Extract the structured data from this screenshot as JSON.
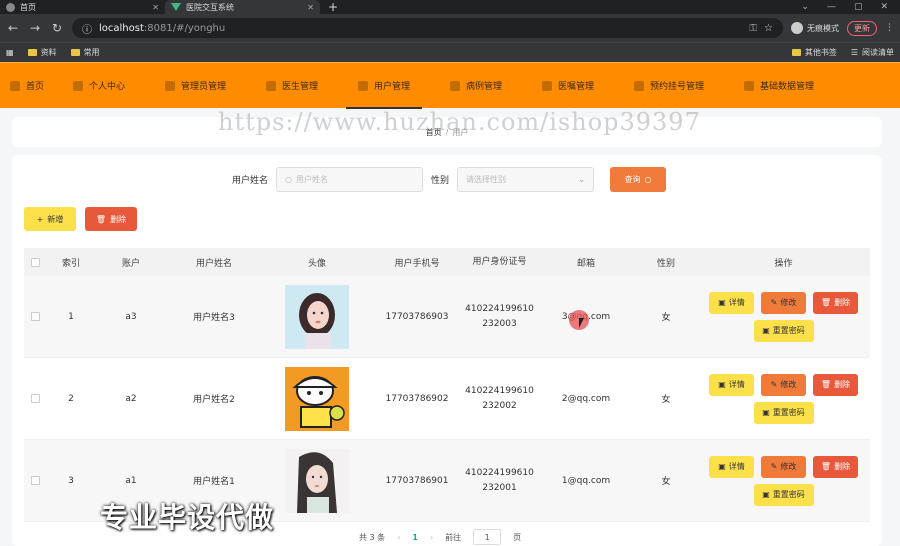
{
  "browser": {
    "tabs": [
      {
        "title": "首页"
      },
      {
        "title": "医院交互系统"
      }
    ],
    "new_tab": "+",
    "url_host": "localhost",
    "url_path": ":8081/#/yonghu",
    "profile_label": "无痕模式",
    "update_label": "更新",
    "bookmarks": [
      "资料",
      "常用"
    ],
    "bookmarks_right": [
      "其他书签",
      "阅读清单"
    ]
  },
  "nav": {
    "items": [
      {
        "label": "首页"
      },
      {
        "label": "个人中心"
      },
      {
        "label": "管理员管理"
      },
      {
        "label": "医生管理"
      },
      {
        "label": "用户管理"
      },
      {
        "label": "病例管理"
      },
      {
        "label": "医嘱管理"
      },
      {
        "label": "预约挂号管理"
      },
      {
        "label": "基础数据管理"
      }
    ],
    "active_index": 4
  },
  "breadcrumb": {
    "home": "首页",
    "separator": "/",
    "current": "用户"
  },
  "watermark": "https://www.huzhan.com/ishop39397",
  "search": {
    "name_label": "用户姓名",
    "name_placeholder": "用户姓名",
    "gender_label": "性别",
    "gender_placeholder": "请选择性别",
    "query_button": "查询"
  },
  "actions": {
    "add_button": "新增",
    "delete_button": "删除"
  },
  "table": {
    "headers": [
      "索引",
      "账户",
      "用户姓名",
      "头像",
      "用户手机号",
      "用户身份证号",
      "邮箱",
      "性别",
      "操作"
    ],
    "rows": [
      {
        "index": "1",
        "account": "a3",
        "name": "用户姓名3",
        "phone": "17703786903",
        "id_line1": "410224199610",
        "id_line2": "232003",
        "email": "3@qq.com",
        "gender": "女"
      },
      {
        "index": "2",
        "account": "a2",
        "name": "用户姓名2",
        "phone": "17703786902",
        "id_line1": "410224199610",
        "id_line2": "232002",
        "email": "2@qq.com",
        "gender": "女"
      },
      {
        "index": "3",
        "account": "a1",
        "name": "用户姓名1",
        "phone": "17703786901",
        "id_line1": "410224199610",
        "id_line2": "232001",
        "email": "1@qq.com",
        "gender": "女"
      }
    ],
    "op_detail": "详情",
    "op_edit": "修改",
    "op_delete": "删除",
    "op_reset": "重置密码"
  },
  "pagination": {
    "total_text": "共 3 条",
    "current_page": "1",
    "goto_label": "前往",
    "goto_value": "1",
    "page_unit": "页"
  },
  "overlay": "专业毕设代做",
  "colors": {
    "nav_bg": "#ff8c00",
    "yellow_button": "#fbe04a",
    "orange_button": "#f07a3a",
    "red_button": "#e8593c",
    "page_active": "#1aa79c"
  }
}
